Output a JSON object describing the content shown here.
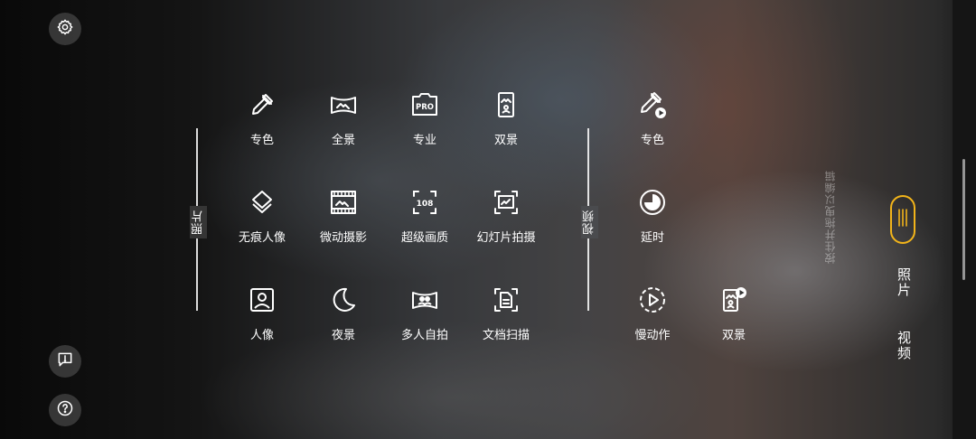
{
  "colors": {
    "accent": "#f2b41a",
    "text": "#ffffff"
  },
  "icons": {
    "settings": "gear-icon",
    "feedback": "feedback-icon",
    "help": "help-icon"
  },
  "photo_section": {
    "label": "照片",
    "modes": [
      {
        "label": "专色",
        "icon": "eyedropper-icon"
      },
      {
        "label": "全景",
        "icon": "panorama-icon"
      },
      {
        "label": "专业",
        "icon": "pro-icon",
        "icon_text": "PRO"
      },
      {
        "label": "双景",
        "icon": "dual-view-icon"
      },
      {
        "label": "无痕人像",
        "icon": "layers-icon"
      },
      {
        "label": "微动摄影",
        "icon": "film-icon"
      },
      {
        "label": "超级画质",
        "icon": "super-quality-icon",
        "icon_text": "108"
      },
      {
        "label": "幻灯片拍摄",
        "icon": "slideshow-icon"
      },
      {
        "label": "人像",
        "icon": "portrait-icon"
      },
      {
        "label": "夜景",
        "icon": "moon-icon"
      },
      {
        "label": "多人自拍",
        "icon": "group-selfie-icon"
      },
      {
        "label": "文档扫描",
        "icon": "document-scan-icon"
      }
    ]
  },
  "video_section": {
    "label": "视频",
    "modes": [
      {
        "label": "专色",
        "icon": "eyedropper-video-icon"
      },
      {
        "label": "延时",
        "icon": "timelapse-icon"
      },
      {
        "label": "慢动作",
        "icon": "slow-motion-icon"
      },
      {
        "label": "双景",
        "icon": "dual-view-video-icon"
      }
    ]
  },
  "edit_hint": "按住并拖曳以编辑",
  "right_tabs": {
    "photo": "照片",
    "video": "视频"
  }
}
